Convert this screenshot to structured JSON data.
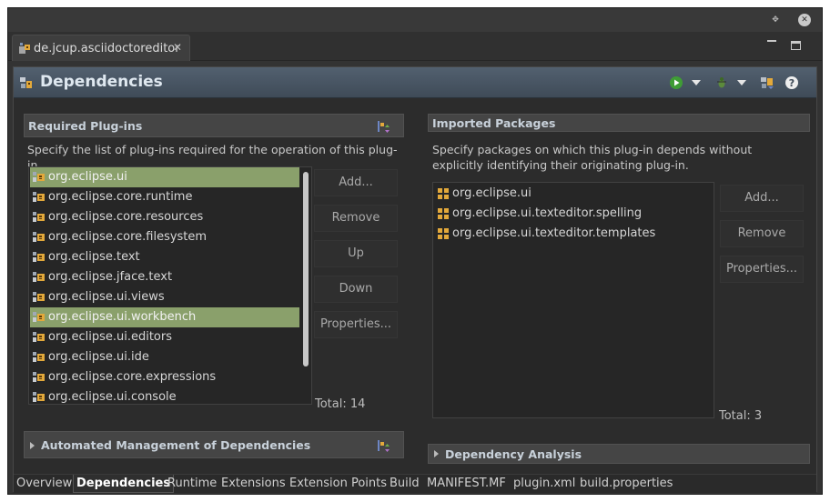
{
  "window": {
    "restore_symbol": "✥",
    "close_symbol": "✕"
  },
  "editor_tab": {
    "title": "de.jcup.asciidoctoreditor",
    "close_symbol": "✕"
  },
  "header": {
    "title": "Dependencies",
    "help_symbol": "?"
  },
  "required_plugins": {
    "title": "Required Plug-ins",
    "description": "Specify the list of plug-ins required for the operation of this plug-in.",
    "items": [
      {
        "label": "org.eclipse.ui",
        "selected": true
      },
      {
        "label": "org.eclipse.core.runtime",
        "selected": false
      },
      {
        "label": "org.eclipse.core.resources",
        "selected": false
      },
      {
        "label": "org.eclipse.core.filesystem",
        "selected": false
      },
      {
        "label": "org.eclipse.text",
        "selected": false
      },
      {
        "label": "org.eclipse.jface.text",
        "selected": false
      },
      {
        "label": "org.eclipse.ui.views",
        "selected": false
      },
      {
        "label": "org.eclipse.ui.workbench",
        "selected": true
      },
      {
        "label": "org.eclipse.ui.editors",
        "selected": false
      },
      {
        "label": "org.eclipse.ui.ide",
        "selected": false
      },
      {
        "label": "org.eclipse.core.expressions",
        "selected": false
      },
      {
        "label": "org.eclipse.ui.console",
        "selected": false
      }
    ],
    "buttons": {
      "add": "Add...",
      "remove": "Remove",
      "up": "Up",
      "down": "Down",
      "properties": "Properties..."
    },
    "total": "Total: 14"
  },
  "imported_packages": {
    "title": "Imported Packages",
    "description": "Specify packages on which this plug-in depends without explicitly identifying their originating plug-in.",
    "items": [
      {
        "label": "org.eclipse.ui"
      },
      {
        "label": "org.eclipse.ui.texteditor.spelling"
      },
      {
        "label": "org.eclipse.ui.texteditor.templates"
      }
    ],
    "buttons": {
      "add": "Add...",
      "remove": "Remove",
      "properties": "Properties..."
    },
    "total": "Total: 3"
  },
  "automated_management": {
    "title": "Automated Management of Dependencies"
  },
  "dependency_analysis": {
    "title": "Dependency Analysis"
  },
  "page_tabs": [
    {
      "label": "Overview",
      "active": false
    },
    {
      "label": "Dependencies",
      "active": true
    },
    {
      "label": "Runtime",
      "active": false
    },
    {
      "label": "Extensions",
      "active": false
    },
    {
      "label": "Extension Points",
      "active": false
    },
    {
      "label": "Build",
      "active": false
    },
    {
      "label": "MANIFEST.MF",
      "active": false
    },
    {
      "label": "plugin.xml",
      "active": false
    },
    {
      "label": "build.properties",
      "active": false
    }
  ],
  "colors": {
    "selection": "#8aa06b",
    "header_gradient_top": "#52606f",
    "header_gradient_bottom": "#3f4b58",
    "background": "#2c2c2c"
  },
  "icons": {
    "plugin": "plugin-icon",
    "package": "package-icon",
    "run": "run-icon",
    "debug": "debug-icon",
    "export": "export-icon",
    "help": "help-icon",
    "sort": "sort-icon"
  }
}
